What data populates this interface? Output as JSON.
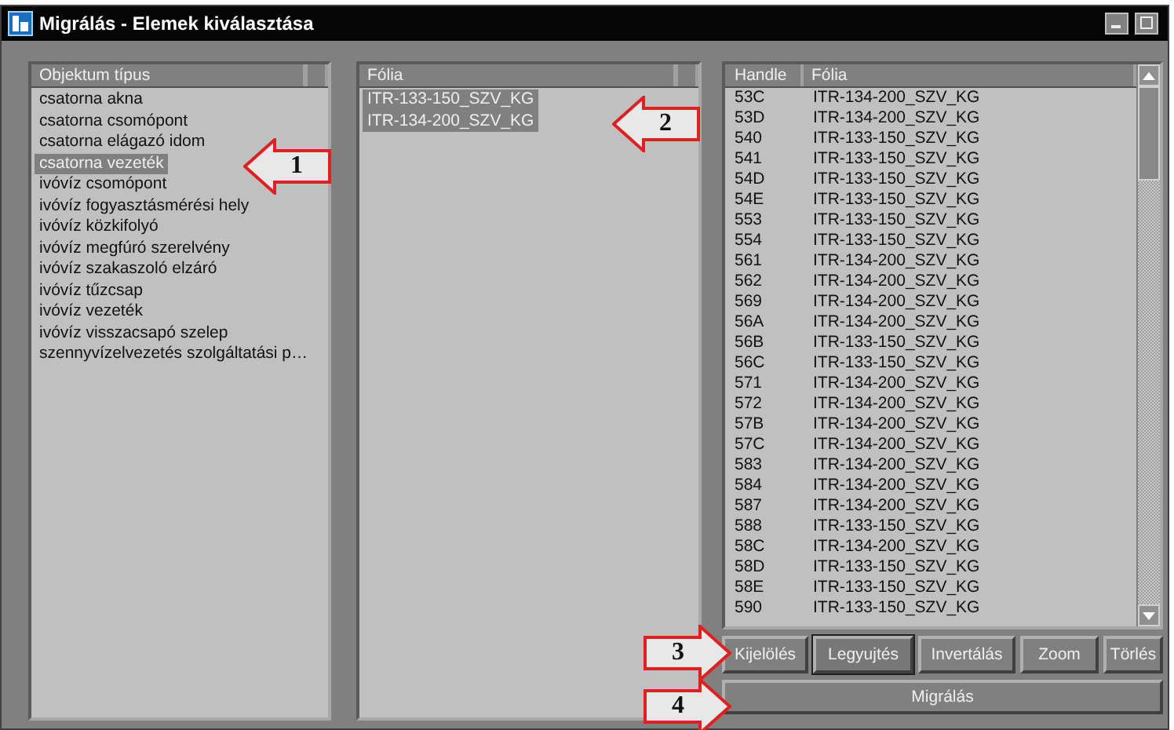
{
  "window": {
    "title": "Migrálás - Elemek kiválasztása"
  },
  "object_types": {
    "header": "Objektum típus",
    "items": [
      {
        "label": "csatorna akna",
        "selected": false
      },
      {
        "label": "csatorna csomópont",
        "selected": false
      },
      {
        "label": "csatorna elágazó idom",
        "selected": false
      },
      {
        "label": "csatorna vezeték",
        "selected": true
      },
      {
        "label": "ivóvíz csomópont",
        "selected": false
      },
      {
        "label": "ivóvíz fogyasztásmérési hely",
        "selected": false
      },
      {
        "label": "ivóvíz közkifolyó",
        "selected": false
      },
      {
        "label": "ivóvíz megfúró szerelvény",
        "selected": false
      },
      {
        "label": "ivóvíz szakaszoló elzáró",
        "selected": false
      },
      {
        "label": "ivóvíz tűzcsap",
        "selected": false
      },
      {
        "label": "ivóvíz vezeték",
        "selected": false
      },
      {
        "label": "ivóvíz visszacsapó szelep",
        "selected": false
      },
      {
        "label": "szennyvízelvezetés szolgáltatási p…",
        "selected": false
      }
    ]
  },
  "layers": {
    "header": "Fólia",
    "items": [
      {
        "label": "ITR-133-150_SZV_KG",
        "selected": true
      },
      {
        "label": "ITR-134-200_SZV_KG",
        "selected": true
      }
    ]
  },
  "elements": {
    "columns": [
      "Handle",
      "Fólia"
    ],
    "rows": [
      [
        "53C",
        "ITR-134-200_SZV_KG"
      ],
      [
        "53D",
        "ITR-134-200_SZV_KG"
      ],
      [
        "540",
        "ITR-133-150_SZV_KG"
      ],
      [
        "541",
        "ITR-133-150_SZV_KG"
      ],
      [
        "54D",
        "ITR-133-150_SZV_KG"
      ],
      [
        "54E",
        "ITR-133-150_SZV_KG"
      ],
      [
        "553",
        "ITR-133-150_SZV_KG"
      ],
      [
        "554",
        "ITR-133-150_SZV_KG"
      ],
      [
        "561",
        "ITR-134-200_SZV_KG"
      ],
      [
        "562",
        "ITR-134-200_SZV_KG"
      ],
      [
        "569",
        "ITR-134-200_SZV_KG"
      ],
      [
        "56A",
        "ITR-134-200_SZV_KG"
      ],
      [
        "56B",
        "ITR-133-150_SZV_KG"
      ],
      [
        "56C",
        "ITR-133-150_SZV_KG"
      ],
      [
        "571",
        "ITR-134-200_SZV_KG"
      ],
      [
        "572",
        "ITR-134-200_SZV_KG"
      ],
      [
        "57B",
        "ITR-134-200_SZV_KG"
      ],
      [
        "57C",
        "ITR-134-200_SZV_KG"
      ],
      [
        "583",
        "ITR-134-200_SZV_KG"
      ],
      [
        "584",
        "ITR-134-200_SZV_KG"
      ],
      [
        "587",
        "ITR-134-200_SZV_KG"
      ],
      [
        "588",
        "ITR-133-150_SZV_KG"
      ],
      [
        "58C",
        "ITR-134-200_SZV_KG"
      ],
      [
        "58D",
        "ITR-133-150_SZV_KG"
      ],
      [
        "58E",
        "ITR-133-150_SZV_KG"
      ],
      [
        "590",
        "ITR-133-150_SZV_KG"
      ]
    ]
  },
  "buttons": [
    {
      "label": "Kijelölés",
      "focused": false
    },
    {
      "label": "Legyujtés",
      "focused": true
    },
    {
      "label": "Invertálás",
      "focused": false
    },
    {
      "label": "Zoom",
      "focused": false
    },
    {
      "label": "Törlés",
      "focused": false
    }
  ],
  "migrate_button": "Migrálás",
  "callouts": [
    {
      "label": "1",
      "kind": "left"
    },
    {
      "label": "2",
      "kind": "left"
    },
    {
      "label": "3",
      "kind": "right"
    },
    {
      "label": "4",
      "kind": "right"
    }
  ]
}
